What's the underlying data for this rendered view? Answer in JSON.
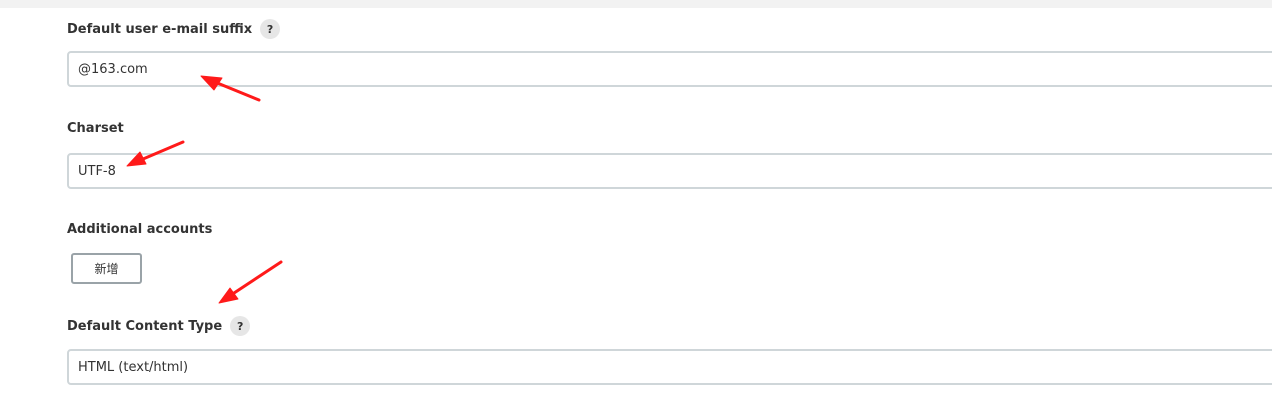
{
  "form": {
    "email_suffix": {
      "label": "Default user e-mail suffix",
      "help_icon": "?",
      "value": "@163.com"
    },
    "charset": {
      "label": "Charset",
      "value": "UTF-8"
    },
    "additional_accounts": {
      "label": "Additional accounts",
      "add_button": "新增"
    },
    "content_type": {
      "label": "Default Content Type",
      "help_icon": "?",
      "value": "HTML (text/html)"
    }
  },
  "colors": {
    "annotation_arrow": "#ff1a1a",
    "field_border": "#cfd6d9"
  }
}
